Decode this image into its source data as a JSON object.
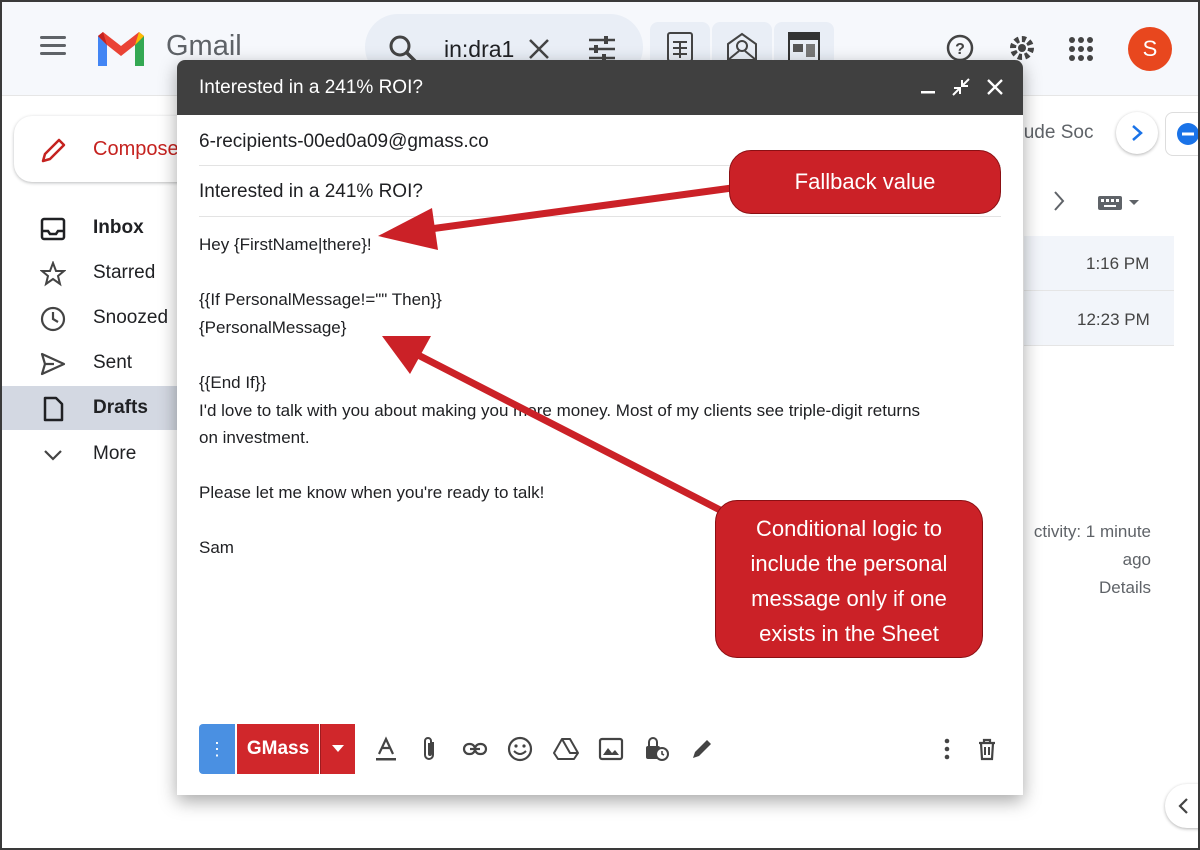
{
  "gmail": {
    "app_name": "Gmail",
    "search_query": "in:dra1",
    "avatar_letter": "S",
    "compose_label": "Compose",
    "nav": [
      {
        "label": "Inbox",
        "icon": "inbox-icon",
        "bold": true
      },
      {
        "label": "Starred",
        "icon": "star-icon"
      },
      {
        "label": "Snoozed",
        "icon": "clock-icon"
      },
      {
        "label": "Sent",
        "icon": "send-icon"
      },
      {
        "label": "Drafts",
        "icon": "draft-icon",
        "bold": true,
        "active": true
      },
      {
        "label": "More",
        "icon": "chevron-down-icon"
      }
    ],
    "right_chip_label": "clude Soc",
    "times": [
      "1:16 PM",
      "12:23 PM"
    ],
    "activity_line1": "ctivity: 1 minute",
    "activity_line2": "ago",
    "details_label": "Details"
  },
  "compose": {
    "window_title": "Interested in a 241% ROI?",
    "to": "6-recipients-00ed0a09@gmass.co",
    "subject": "Interested in a 241% ROI?",
    "body_lines": [
      "Hey {FirstName|there}!",
      "",
      "{{If PersonalMessage!=\"\" Then}}",
      "{PersonalMessage}",
      "",
      "{{End If}}",
      "I'd love to talk with you about making you more money. Most of my clients see triple-digit returns",
      "on investment.",
      "",
      "Please let me know when you're ready to talk!",
      "",
      "Sam"
    ],
    "gmass_label": "GMass",
    "send_options_glyph": "⋮"
  },
  "annotations": {
    "fallback": "Fallback value",
    "conditional": "Conditional logic to\ninclude the personal\nmessage only if one\nexists in the Sheet"
  },
  "colors": {
    "callout_red": "#cb2127",
    "gmass_red": "#d0272b",
    "header_dark": "#404040",
    "send_blue": "#4a90e2"
  }
}
